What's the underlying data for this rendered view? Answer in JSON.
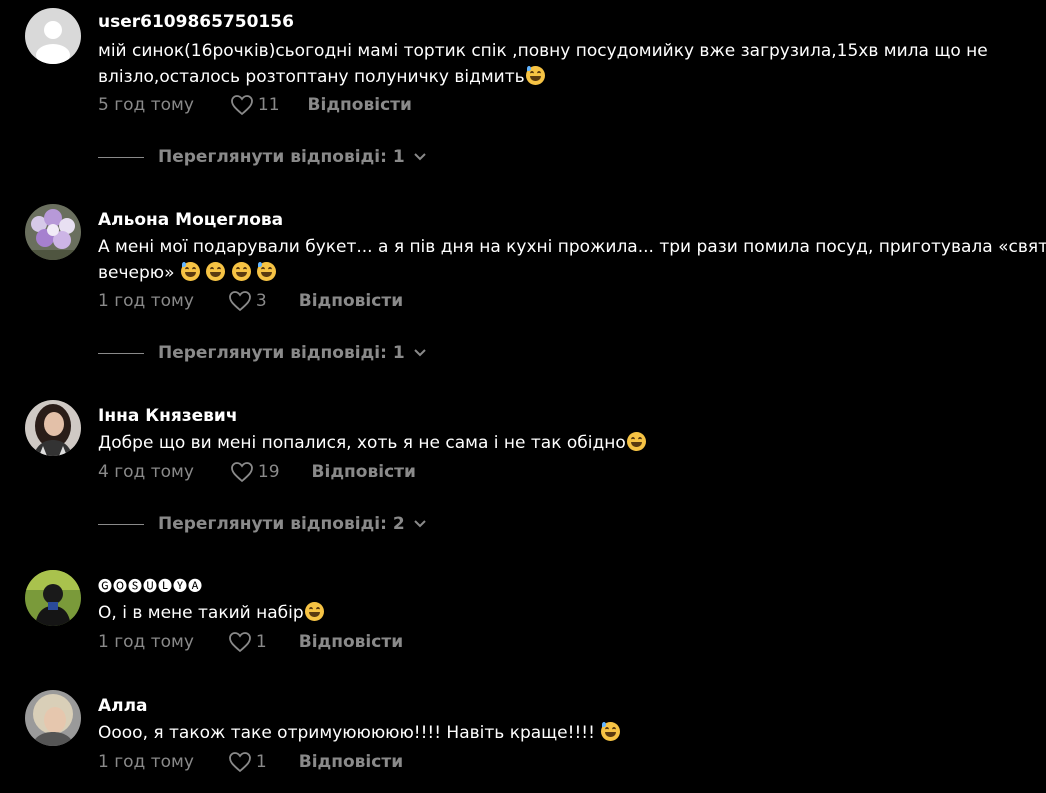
{
  "comments": [
    {
      "author": "user6109865750156",
      "text_line1": "мій синок(16рочків)сьогодні мамі тортик спік ,повну посудомийку вже загрузила,15хв мила що не",
      "text_line2": "влізло,осталось розтоптану полуничку відмить",
      "time": "5 год тому",
      "likes": "11",
      "reply_label": "Відповісти",
      "view_replies": "Переглянути відповіді: 1",
      "avatar": "default-avatar-icon"
    },
    {
      "author": "Альона Моцеглова",
      "text_line1": "А мені мої подарували букет... а я пів дня на кухні прожила... три рази помила посуд, приготувала «святкову",
      "text_line2": "вечерю»",
      "time": "1 год тому",
      "likes": "3",
      "reply_label": "Відповісти",
      "view_replies": "Переглянути відповіді: 1",
      "avatar": "flowers-avatar"
    },
    {
      "author": "Інна Князевич",
      "text_line1": "Добре що ви мені попалися, хоть я не сама і не так обідно",
      "time": "4 год тому",
      "likes": "19",
      "reply_label": "Відповісти",
      "view_replies": "Переглянути відповіді: 2",
      "avatar": "woman-avatar"
    },
    {
      "author": "🅖🅞🅢🅤🅛🅨🅐",
      "text_line1": "О, і в мене такий набір",
      "time": "1 год тому",
      "likes": "1",
      "reply_label": "Відповісти",
      "avatar": "person-avatar"
    },
    {
      "author": "Алла",
      "text_line1": "Оооо, я також таке отримуююююю!!!! Навіть краще!!!!",
      "time": "1 год тому",
      "likes": "1",
      "reply_label": "Відповісти",
      "avatar": "blonde-avatar"
    }
  ],
  "colors": {
    "background": "#000000",
    "text": "#ffffff",
    "muted": "#8a8a8a",
    "emoji": "#f6c344"
  }
}
